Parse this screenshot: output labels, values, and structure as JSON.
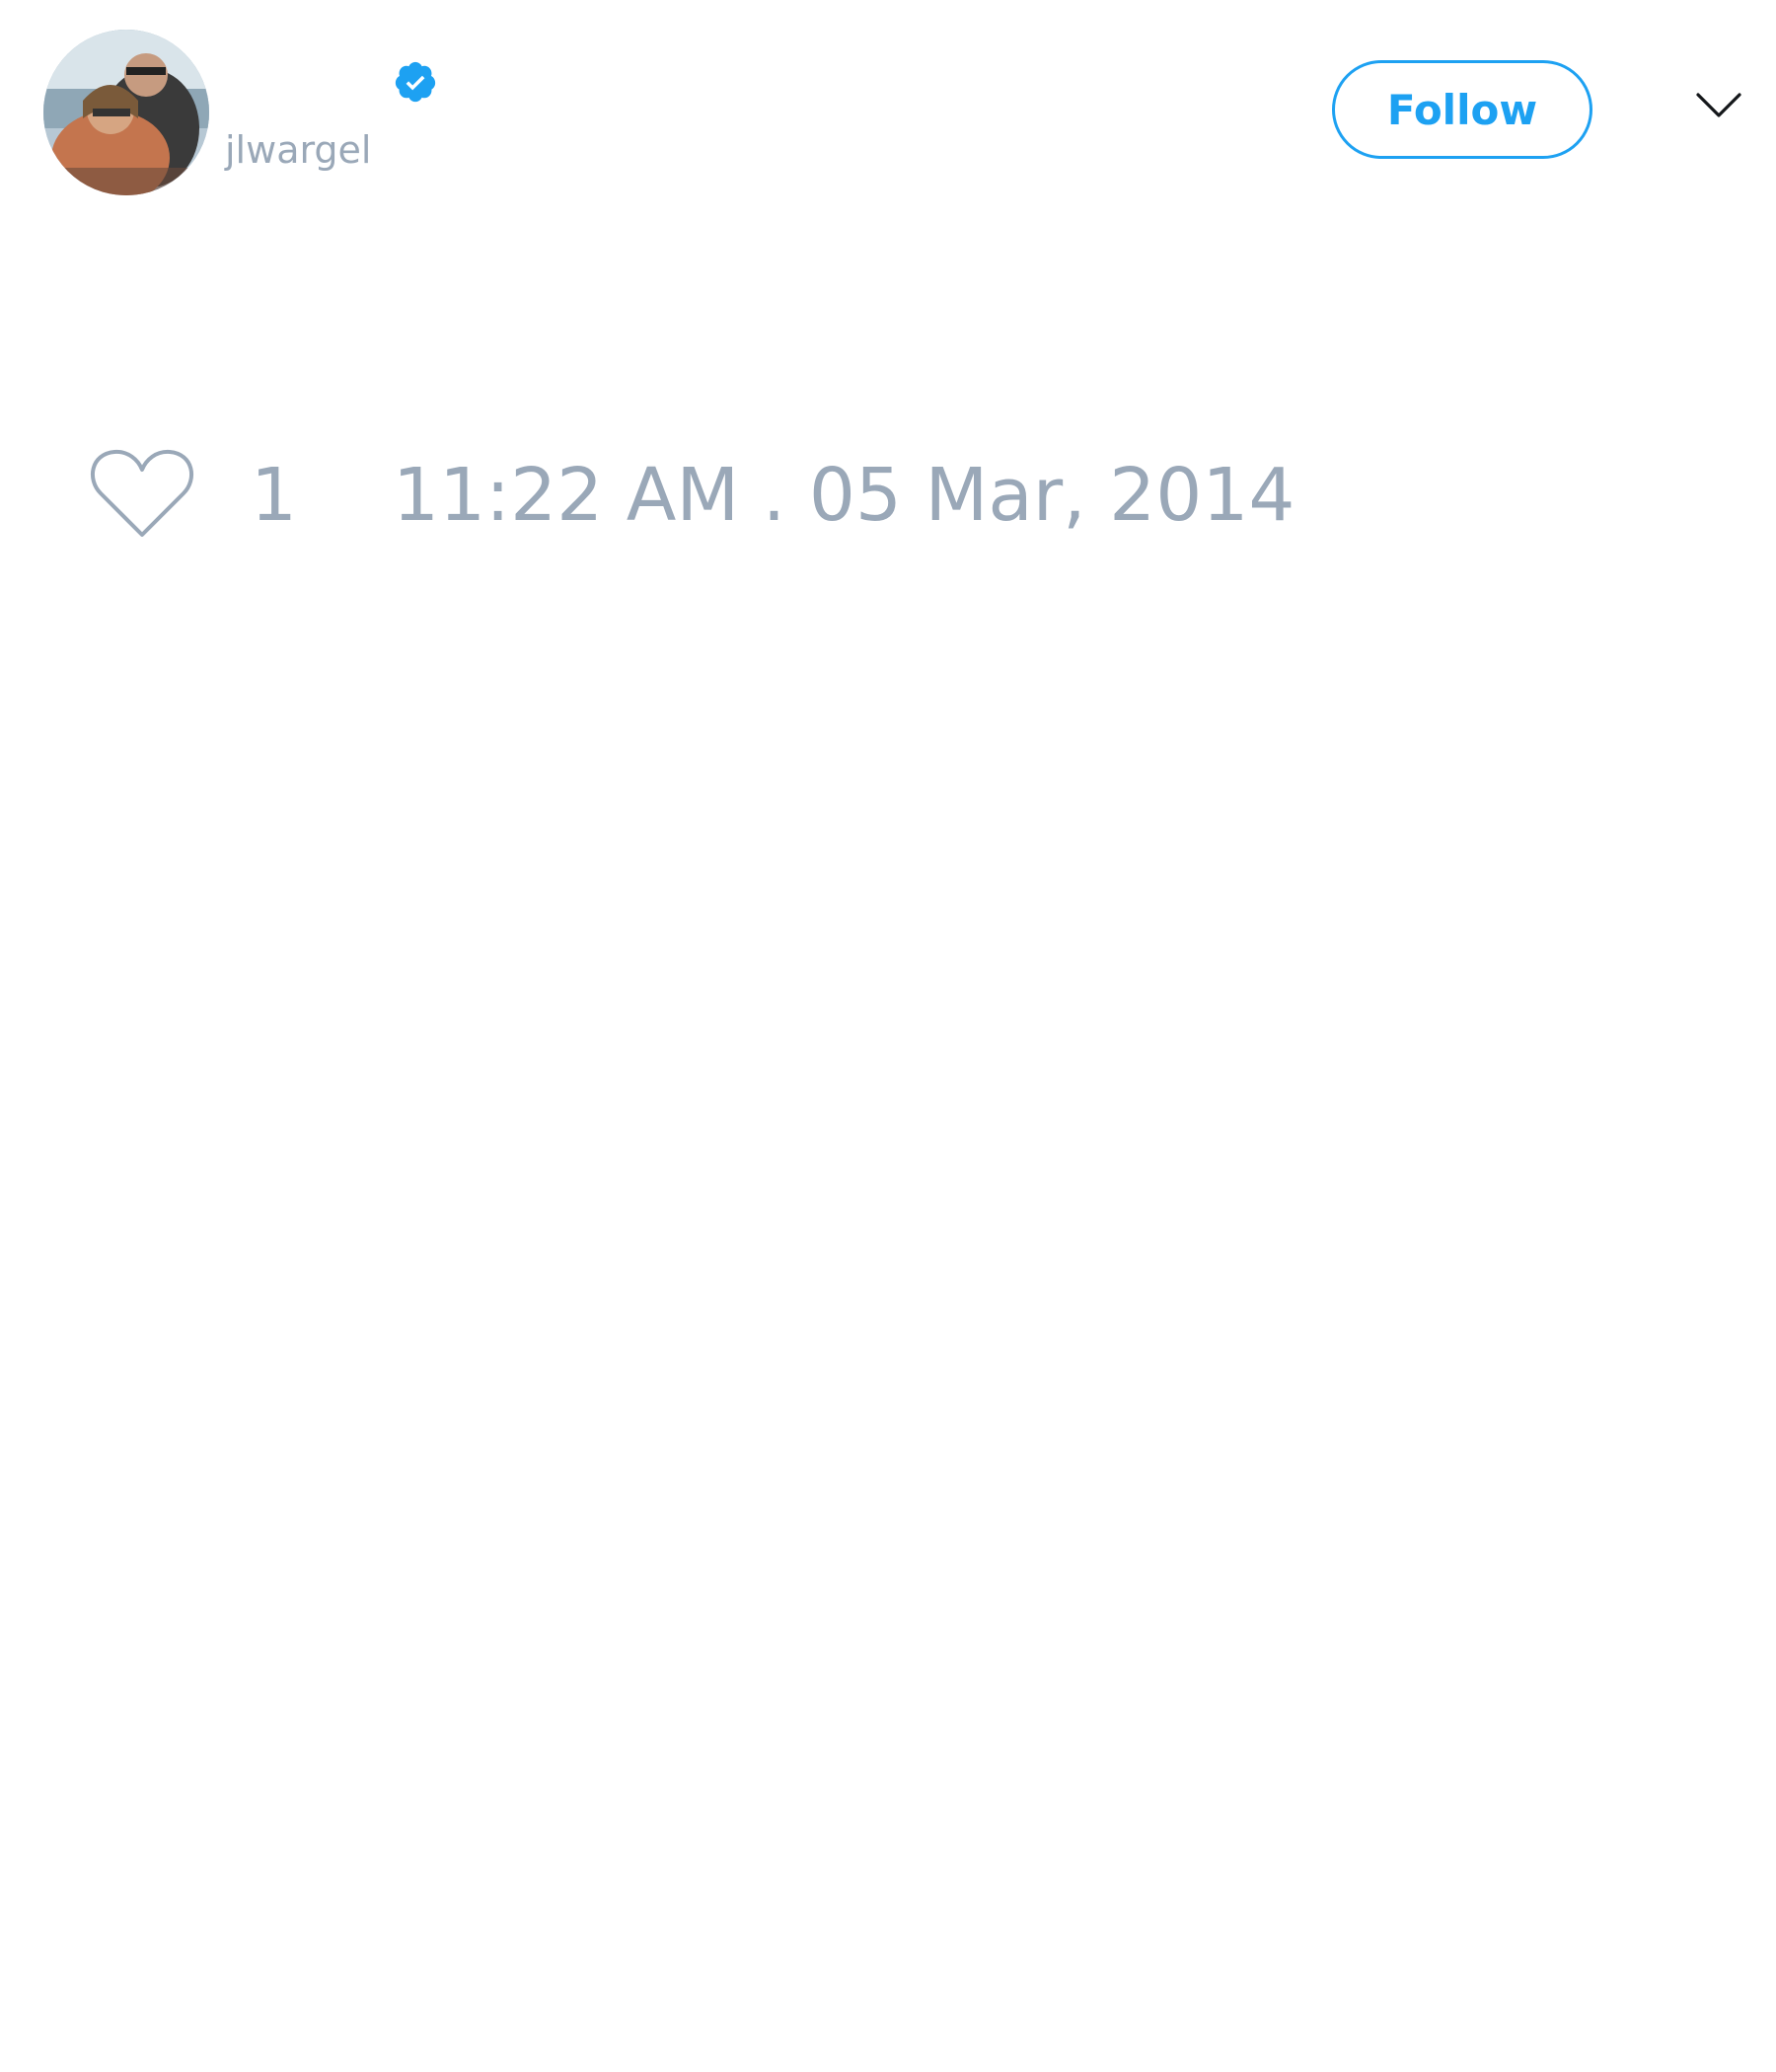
{
  "tweet": {
    "author": {
      "handle": "jlwargel",
      "verified_icon": "verified-badge-icon",
      "avatar_icon": "profile-photo"
    },
    "follow_label": "Follow",
    "menu_icon": "chevron-down-icon",
    "like_icon": "heart-outline-icon",
    "like_count": "1",
    "timestamp": "11:22 AM . 05 Mar, 2014"
  },
  "colors": {
    "accent": "#1da1f2",
    "muted_text": "#9aa8b8",
    "background": "#ffffff"
  }
}
